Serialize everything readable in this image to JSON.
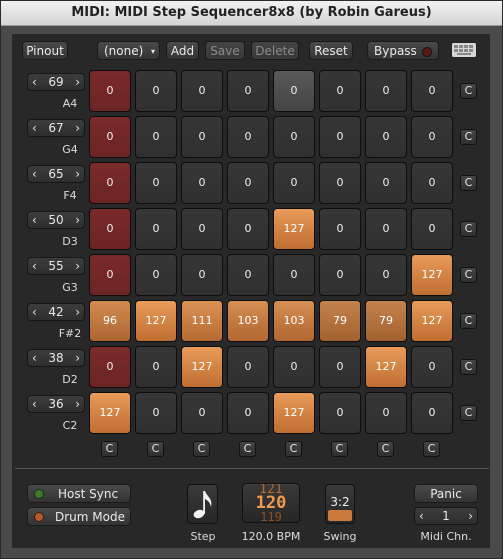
{
  "window": {
    "title": "MIDI: MIDI Step Sequencer8x8 (by Robin Gareus)"
  },
  "toolbar": {
    "pinout_label": "Pinout",
    "preset_value": "(none)",
    "add_label": "Add",
    "save_label": "Save",
    "delete_label": "Delete",
    "reset_label": "Reset",
    "bypass_label": "Bypass"
  },
  "rows": [
    {
      "note_number": "69",
      "note_name": "A4",
      "clear_label": "C"
    },
    {
      "note_number": "67",
      "note_name": "G4",
      "clear_label": "C"
    },
    {
      "note_number": "65",
      "note_name": "F4",
      "clear_label": "C"
    },
    {
      "note_number": "50",
      "note_name": "D3",
      "clear_label": "C"
    },
    {
      "note_number": "55",
      "note_name": "G3",
      "clear_label": "C"
    },
    {
      "note_number": "42",
      "note_name": "F#2",
      "clear_label": "C"
    },
    {
      "note_number": "38",
      "note_name": "D2",
      "clear_label": "C"
    },
    {
      "note_number": "36",
      "note_name": "C2",
      "clear_label": "C"
    }
  ],
  "grid": [
    [
      "0",
      "0",
      "0",
      "0",
      "0",
      "0",
      "0",
      "0"
    ],
    [
      "0",
      "0",
      "0",
      "0",
      "0",
      "0",
      "0",
      "0"
    ],
    [
      "0",
      "0",
      "0",
      "0",
      "0",
      "0",
      "0",
      "0"
    ],
    [
      "0",
      "0",
      "0",
      "0",
      "127",
      "0",
      "0",
      "0"
    ],
    [
      "0",
      "0",
      "0",
      "0",
      "0",
      "0",
      "0",
      "127"
    ],
    [
      "96",
      "127",
      "111",
      "103",
      "103",
      "79",
      "79",
      "127"
    ],
    [
      "0",
      "0",
      "127",
      "0",
      "0",
      "0",
      "127",
      "0"
    ],
    [
      "127",
      "0",
      "0",
      "0",
      "127",
      "0",
      "0",
      "0"
    ]
  ],
  "playhead_column": 0,
  "highlight_column": 4,
  "column_clear_labels": [
    "C",
    "C",
    "C",
    "C",
    "C",
    "C",
    "C",
    "C"
  ],
  "bottom": {
    "host_sync_label": "Host Sync",
    "drum_mode_label": "Drum Mode",
    "step_label": "Step",
    "bpm_display": [
      "121",
      "120",
      "119"
    ],
    "bpm_label": "120.0 BPM",
    "swing_value": "3:2",
    "swing_label": "Swing",
    "panic_label": "Panic",
    "midi_channel_value": "1",
    "midi_channel_label": "Midi Chn."
  },
  "colors": {
    "active_step": "#c97a3c",
    "playhead": "#6b2424",
    "empty_step": "#303030"
  }
}
